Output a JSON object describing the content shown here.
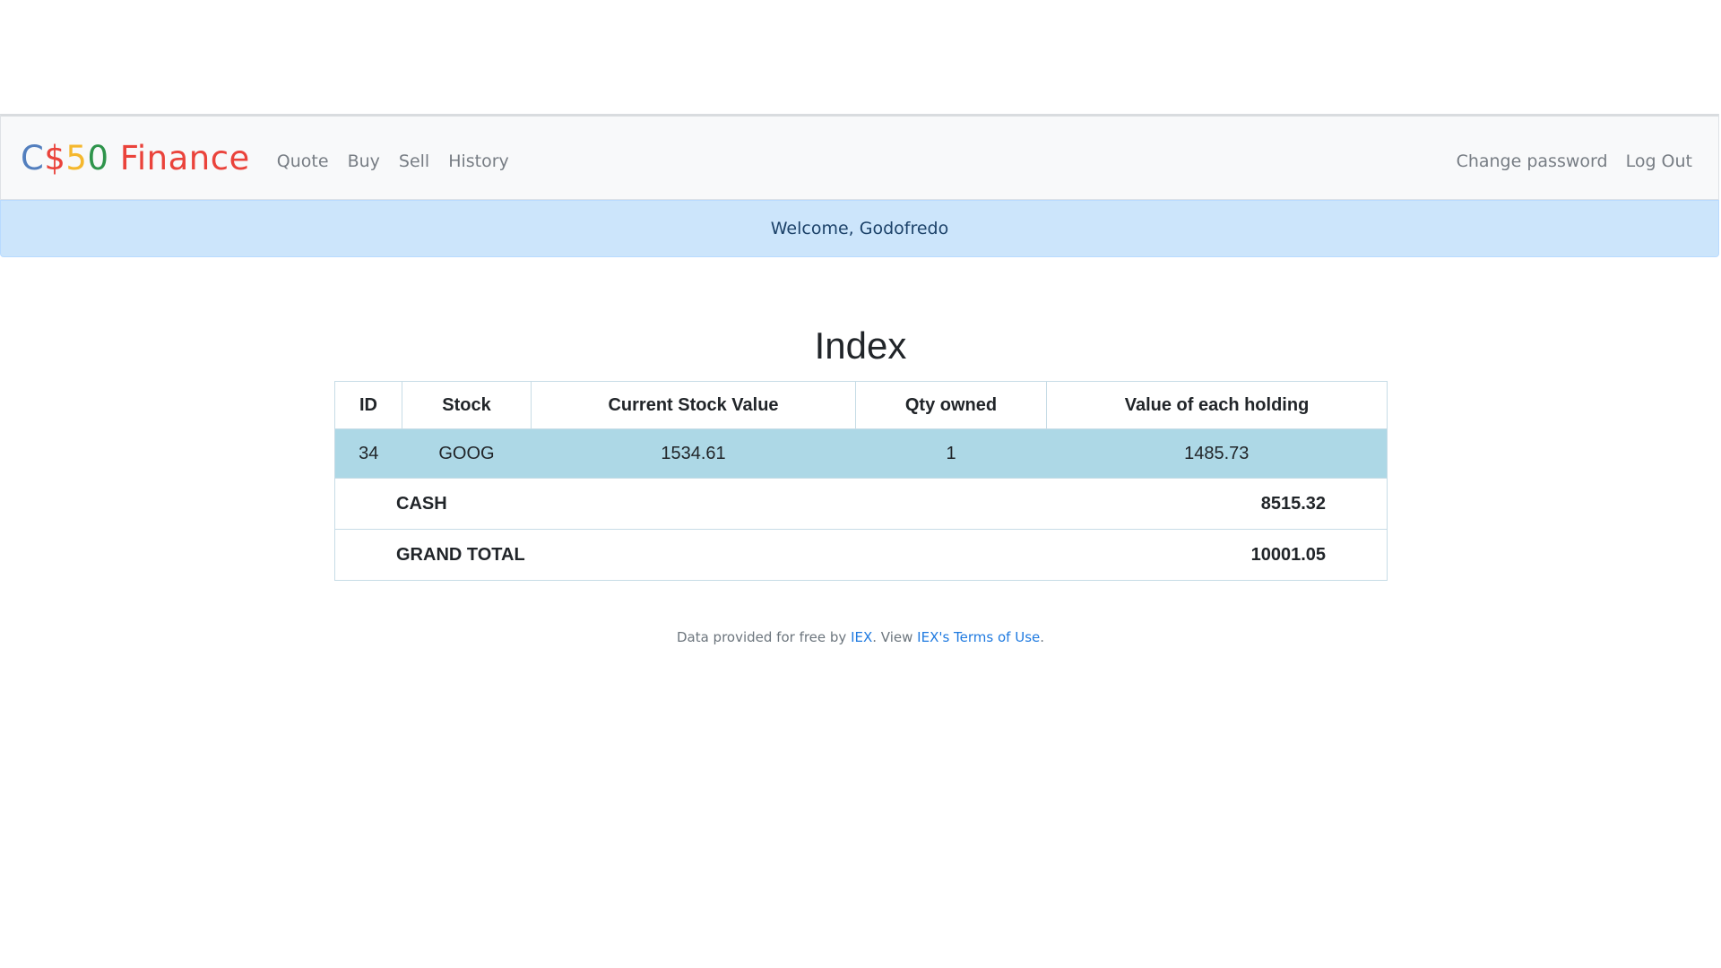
{
  "brand": {
    "parts": [
      {
        "text": "C",
        "color": "#537fbe"
      },
      {
        "text": "$",
        "color": "#ea433b"
      },
      {
        "text": "5",
        "color": "#f5b82e"
      },
      {
        "text": "0",
        "color": "#2e944b"
      },
      {
        "text": " Finance",
        "color": "#ea433b"
      }
    ]
  },
  "nav": {
    "left": [
      "Quote",
      "Buy",
      "Sell",
      "History"
    ],
    "right": [
      "Change password",
      "Log Out"
    ]
  },
  "alert": {
    "message": "Welcome, Godofredo"
  },
  "page": {
    "title": "Index"
  },
  "table": {
    "headers": [
      "ID",
      "Stock",
      "Current Stock Value",
      "Qty owned",
      "Value of each holding"
    ],
    "rows": [
      [
        "34",
        "GOOG",
        "1534.61",
        "1",
        "1485.73"
      ]
    ],
    "cash": {
      "label": "CASH",
      "value": "8515.32"
    },
    "total": {
      "label": "GRAND TOTAL",
      "value": "10001.05"
    }
  },
  "footer": {
    "prefix": "Data provided for free by ",
    "link1": "IEX",
    "middle": ". View ",
    "link2": "IEX's Terms of Use",
    "suffix": "."
  }
}
